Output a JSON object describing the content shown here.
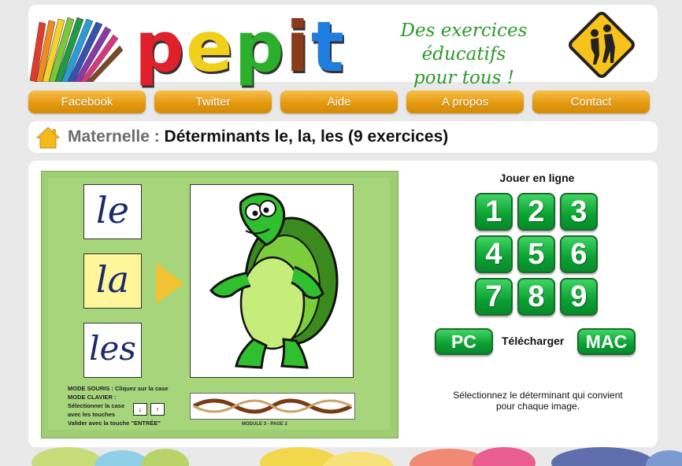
{
  "header": {
    "logo_letters": [
      {
        "char": "p",
        "color": "#e0202a"
      },
      {
        "char": "e",
        "color": "#f0d01a"
      },
      {
        "char": "p",
        "color": "#2ab02a"
      },
      {
        "char": "i",
        "color": "#8a3b1a"
      },
      {
        "char": "t",
        "color": "#1e7ee0"
      }
    ],
    "tagline_line1": "Des exercices éducatifs",
    "tagline_line2": "pour tous !"
  },
  "nav": [
    {
      "label": "Facebook"
    },
    {
      "label": "Twitter"
    },
    {
      "label": "Aide"
    },
    {
      "label": "A propos"
    },
    {
      "label": "Contact"
    }
  ],
  "breadcrumb": {
    "level": "Maternelle :",
    "title": "Déterminants le, la, les (9 exercices)"
  },
  "preview": {
    "cards": [
      "le",
      "la",
      "les"
    ],
    "highlighted_card": "la",
    "instructions": [
      "MODE SOURIS : Cliquez sur la case",
      "MODE CLAVIER :",
      "Sélectionner la case",
      "avec les touches",
      "Valider avec la touche \"ENTRÉE\""
    ],
    "page_label": "MODULE 3 - PAGE 2"
  },
  "play": {
    "title": "Jouer en ligne",
    "exercises": [
      "1",
      "2",
      "3",
      "4",
      "5",
      "6",
      "7",
      "8",
      "9"
    ]
  },
  "download": {
    "pc_label": "PC",
    "label": "Télécharger",
    "mac_label": "MAC"
  },
  "instructions": {
    "line1": "Sélectionnez le déterminant qui convient",
    "line2": "pour chaque image."
  },
  "colors": {
    "nav_orange": "#e49a10",
    "button_green": "#0aa033",
    "preview_green": "#a7d57c"
  }
}
